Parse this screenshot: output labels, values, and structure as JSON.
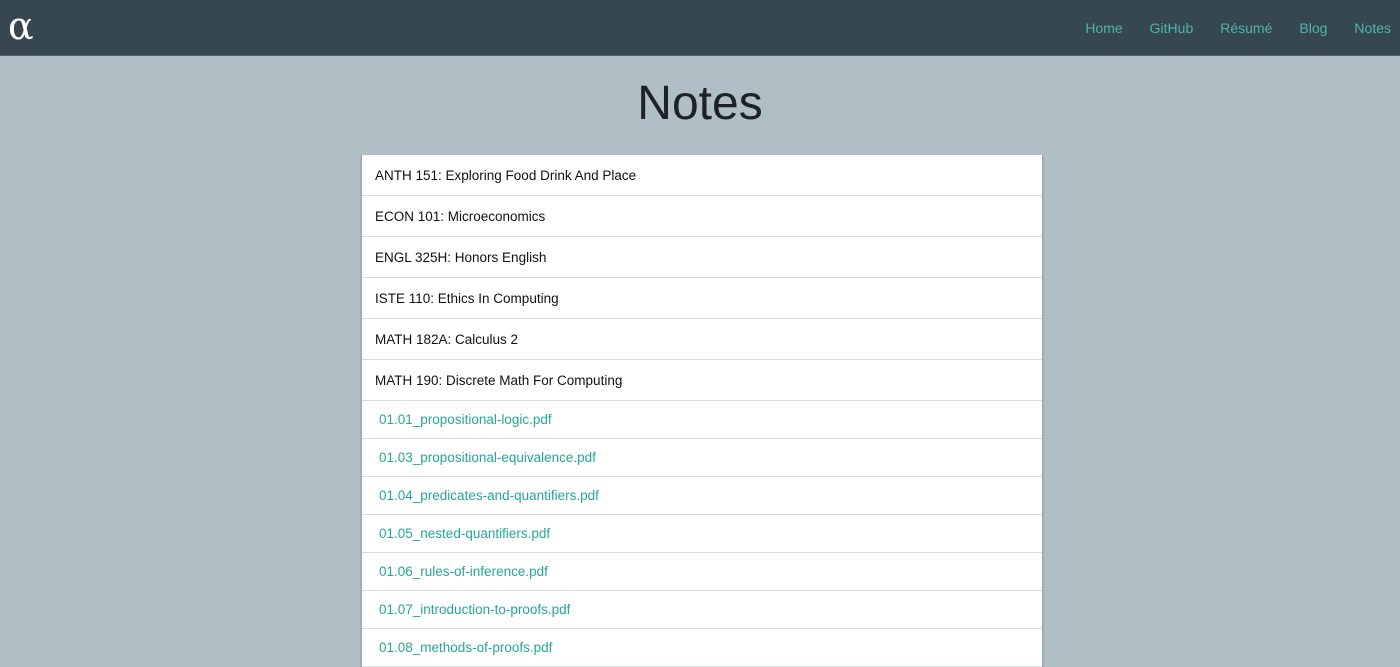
{
  "header": {
    "logo": "α",
    "nav": [
      "Home",
      "GitHub",
      "Résumé",
      "Blog",
      "Notes"
    ]
  },
  "page": {
    "title": "Notes"
  },
  "courses": [
    "ANTH 151: Exploring Food Drink And Place",
    "ECON 101: Microeconomics",
    "ENGL 325H: Honors English",
    "ISTE 110: Ethics In Computing",
    "MATH 182A: Calculus 2",
    "MATH 190: Discrete Math For Computing"
  ],
  "files": [
    "01.01_propositional-logic.pdf",
    "01.03_propositional-equivalence.pdf",
    "01.04_predicates-and-quantifiers.pdf",
    "01.05_nested-quantifiers.pdf",
    "01.06_rules-of-inference.pdf",
    "01.07_introduction-to-proofs.pdf",
    "01.08_methods-of-proofs.pdf"
  ],
  "colors": {
    "navbar": "#37474f",
    "background": "#b0bec5",
    "link": "#4db6ac"
  }
}
